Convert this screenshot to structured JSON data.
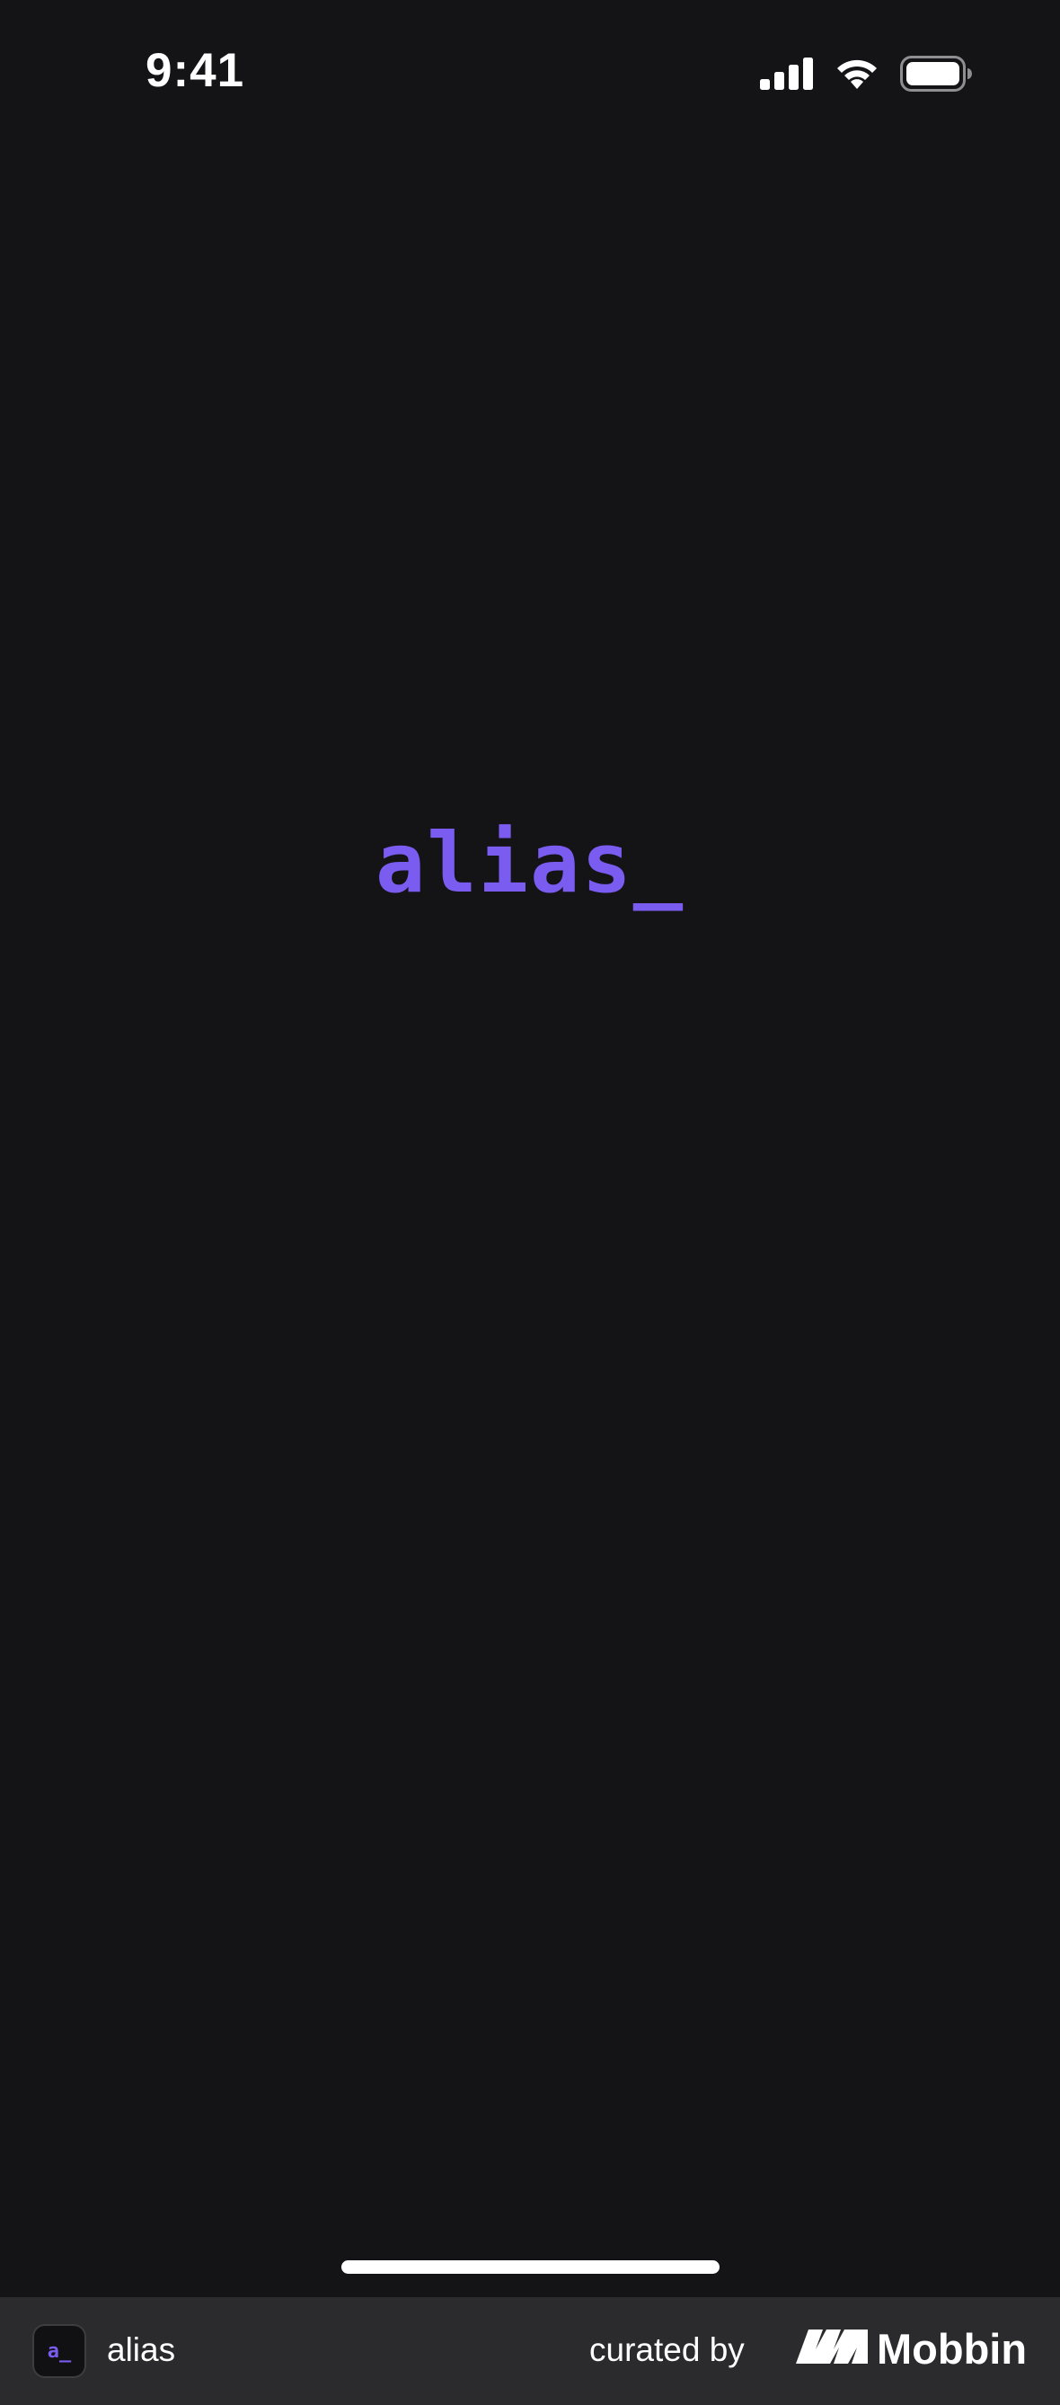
{
  "status_bar": {
    "time": "9:41",
    "icons": [
      "cellular-signal-icon",
      "wifi-icon",
      "battery-icon"
    ]
  },
  "splash": {
    "logo_text": "alias_"
  },
  "footer": {
    "app_icon_glyph": "a_",
    "app_name": "alias",
    "curated_label": "curated by",
    "brand_name": "Mobbin"
  },
  "colors": {
    "background": "#141316",
    "accent": "#7b5cf0",
    "footer_background": "#2b2b2d",
    "text": "#ffffff"
  }
}
